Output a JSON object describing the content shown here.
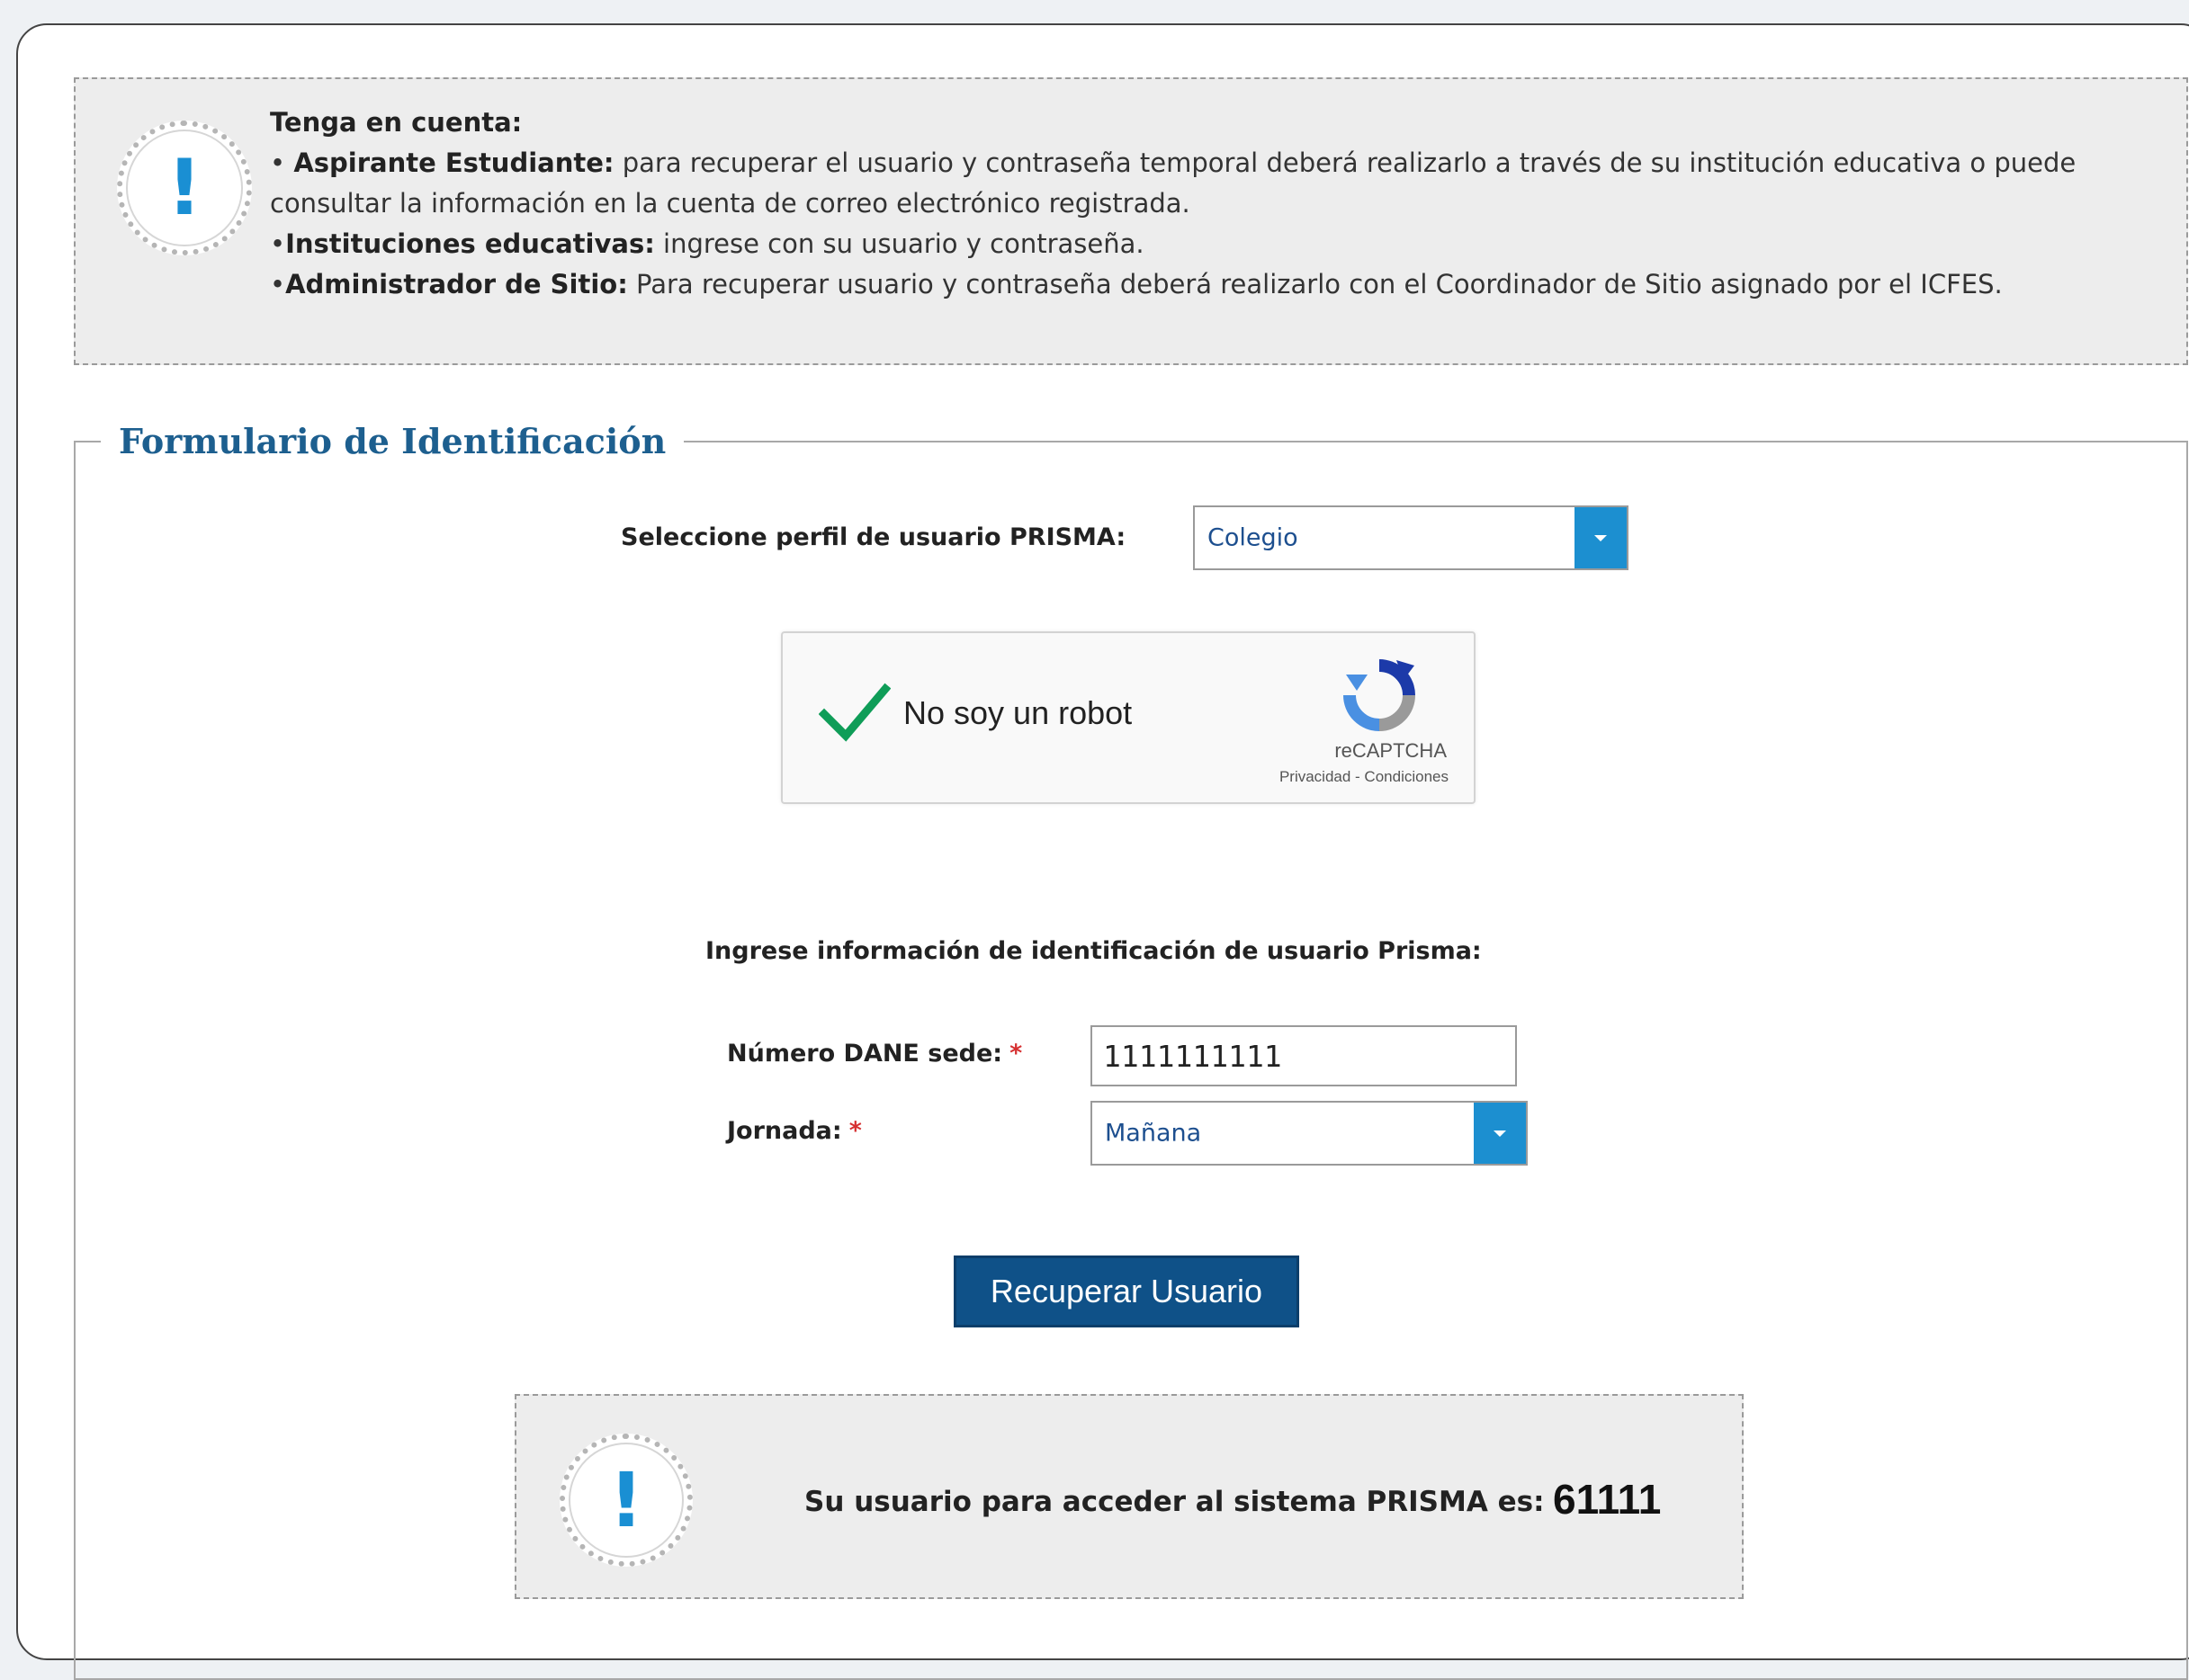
{
  "notice": {
    "icon": "exclamation-icon",
    "title": "Tenga en cuenta:",
    "items": [
      {
        "bullet": "•",
        "label": "Aspirante Estudiante:",
        "text": " para recuperar el usuario y contraseña temporal deberá realizarlo a través de su institución educativa o puede consultar la información en la cuenta de correo electrónico registrada."
      },
      {
        "bullet": "•",
        "label": "Instituciones educativas:",
        "text": " ingrese con su usuario y contraseña."
      },
      {
        "bullet": "•",
        "label": "Administrador de Sitio:",
        "text": " Para recuperar usuario y contraseña deberá realizarlo con el Coordinador de Sitio asignado por el ICFES."
      }
    ]
  },
  "form": {
    "legend": "Formulario de Identificación",
    "profile_label": "Seleccione perfil de usuario PRISMA:",
    "profile_value": "Colegio",
    "captcha": {
      "label": "No soy un robot",
      "brand": "reCAPTCHA",
      "terms": "Privacidad - Condiciones",
      "checked": true
    },
    "section_title": "Ingrese información de identificación de usuario Prisma:",
    "dane_label": "Número DANE sede:",
    "dane_value": "1111111111",
    "jornada_label": "Jornada:",
    "jornada_value": "Mañana",
    "required_marker": "*",
    "submit_label": "Recuperar Usuario"
  },
  "result": {
    "label": "Su usuario para acceder al sistema PRISMA es:",
    "value": "61111"
  },
  "colors": {
    "accent_blue": "#1c8fd0",
    "button_blue": "#0f5188",
    "legend_blue": "#1d5f8f",
    "check_green": "#0f9d58",
    "required_red": "#d63031",
    "notice_bg": "#ededed"
  }
}
